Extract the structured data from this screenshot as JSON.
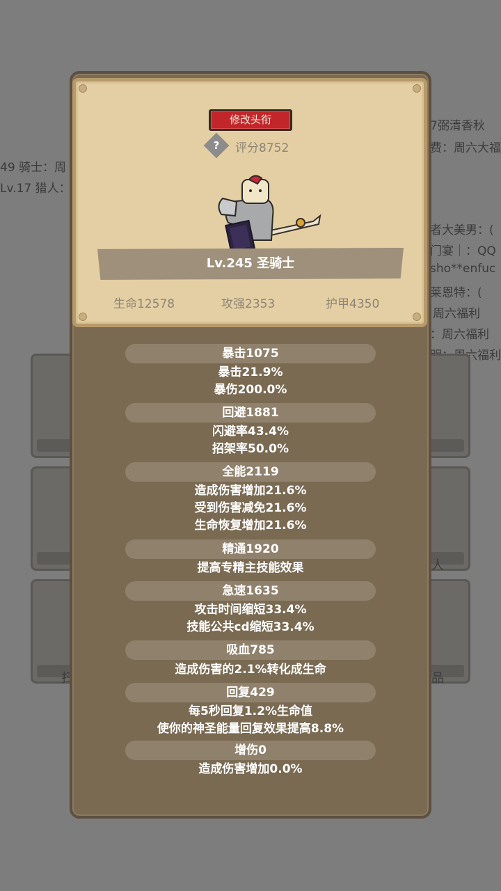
{
  "background": {
    "fragments": [
      {
        "text": "49 骑士：周"
      },
      {
        "text": "Lv.17 猎人："
      },
      {
        "text": "7弼清香秋"
      },
      {
        "text": "费：周六大福"
      },
      {
        "text": "者大美男：("
      },
      {
        "text": "门宴｜：QQ"
      },
      {
        "text": "sho**enfuc"
      },
      {
        "text": "莱恩特：("
      },
      {
        "text": "周六福利"
      },
      {
        "text": "：周六福利"
      },
      {
        "text": "明：周六福利"
      }
    ],
    "card_labels": [
      "人",
      "扫",
      "品"
    ]
  },
  "profile": {
    "edit_title_button": "修改头衔",
    "score": "评分8752",
    "character_name": "Lv.245 圣骑士",
    "base_stats": {
      "hp": "生命12578",
      "attack": "攻强2353",
      "armor": "护甲4350"
    }
  },
  "stats": [
    {
      "header": "暴击1075",
      "lines": [
        "暴击21.9%",
        "暴伤200.0%"
      ]
    },
    {
      "header": "回避1881",
      "lines": [
        "闪避率43.4%",
        "招架率50.0%"
      ]
    },
    {
      "header": "全能2119",
      "lines": [
        "造成伤害增加21.6%",
        "受到伤害减免21.6%",
        "生命恢复增加21.6%"
      ]
    },
    {
      "header": "精通1920",
      "lines": [
        "提高专精主技能效果"
      ]
    },
    {
      "header": "急速1635",
      "lines": [
        "攻击时间缩短33.4%",
        "技能公共cd缩短33.4%"
      ]
    },
    {
      "header": "吸血785",
      "lines": [
        "造成伤害的2.1%转化成生命"
      ]
    },
    {
      "header": "回复429",
      "lines": [
        "每5秒回复1.2%生命值",
        "使你的神圣能量回复效果提高8.8%"
      ]
    },
    {
      "header": "增伤0",
      "lines": [
        "造成伤害增加0.0%"
      ]
    }
  ],
  "colors": {
    "button_red": "#c3262a",
    "parchment": "#e4cfa4",
    "panel_brown": "#7a6a52"
  }
}
